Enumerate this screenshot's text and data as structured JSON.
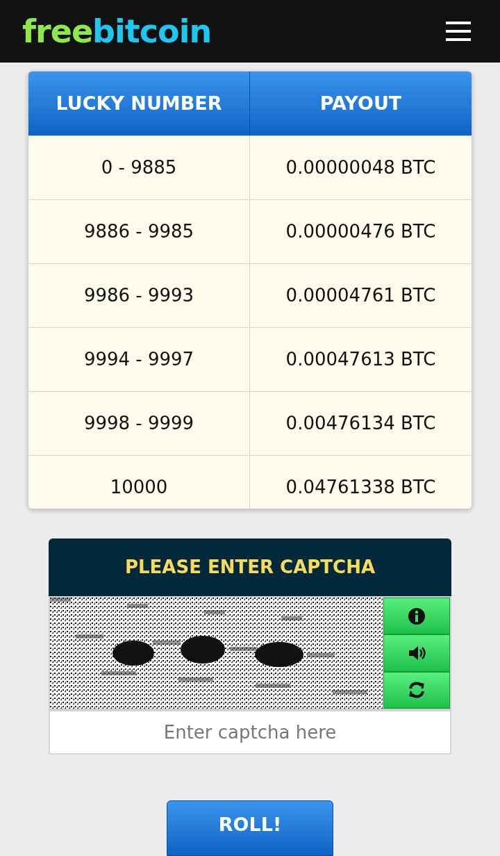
{
  "header": {
    "logo_first": "free",
    "logo_second": "bitcoin"
  },
  "table": {
    "columns": [
      "LUCKY NUMBER",
      "PAYOUT"
    ],
    "rows": [
      [
        "0 - 9885",
        "0.00000048 BTC"
      ],
      [
        "9886 - 9985",
        "0.00000476 BTC"
      ],
      [
        "9986 - 9993",
        "0.00004761 BTC"
      ],
      [
        "9994 - 9997",
        "0.00047613 BTC"
      ],
      [
        "9998 - 9999",
        "0.00476134 BTC"
      ],
      [
        "10000",
        "0.04761338 BTC"
      ]
    ]
  },
  "captcha": {
    "title": "PLEASE ENTER CAPTCHA",
    "placeholder": "Enter captcha here"
  },
  "roll_button": "ROLL!"
}
